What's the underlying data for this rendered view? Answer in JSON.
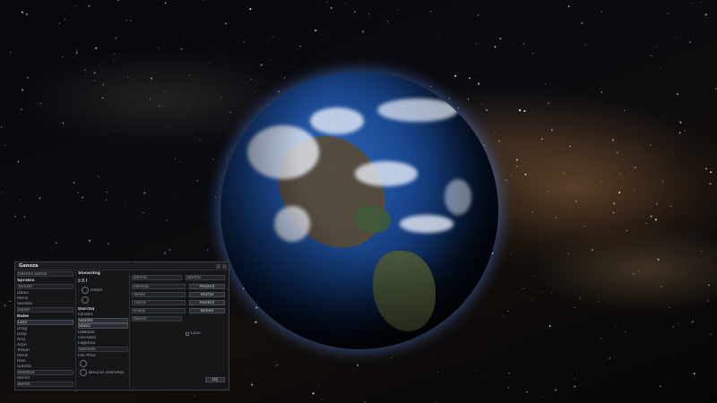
{
  "window": {
    "title": "Ganoza",
    "buttons": [
      "",
      ""
    ]
  },
  "left": {
    "search": "Dasnes oolnal",
    "header1": "Sprakis",
    "dropdown1": "Tamzel",
    "items1": [
      "Dalos",
      "Rensl",
      "Sandza",
      "Deser"
    ],
    "header2": "Robe",
    "dropdown2": "Loss",
    "items2": [
      "Drag",
      "Diep",
      "Aria",
      "Arpe",
      "#Rear",
      "Rend",
      "Rles",
      "Suorko"
    ],
    "dropdown3": "Redstoir",
    "items3": [
      "Renon"
    ],
    "dropdown4": "Berlar"
  },
  "mid": {
    "header": "Sheardng",
    "value": "EXT",
    "option_label": "Dlaon",
    "section": "Dorcha",
    "subsection": "Fanalid",
    "list": [
      "Sealite",
      "Staos"
    ],
    "list2": [
      "Dabaser",
      "Fonnator",
      "Fagehou",
      "Salneon"
    ],
    "group": "Fan Pfad",
    "radio_label": "Bleucer Rasnetac"
  },
  "right": {
    "header_a": "Domal",
    "header_b": "Rormo",
    "fields": [
      {
        "label": "",
        "value": "Ferenal",
        "btn": "Peoand"
      },
      {
        "label": "",
        "value": "Tenes",
        "btn": "Roctal"
      },
      {
        "label": "",
        "value": "Tiorce",
        "btn": "Rovted"
      },
      {
        "label": "",
        "value": "Frana",
        "btn": "Boned"
      }
    ],
    "bottom_left": "Rovcd",
    "bottom_right": "Lous",
    "footer_btn": "Ok"
  },
  "accent": "#4a7fd6"
}
